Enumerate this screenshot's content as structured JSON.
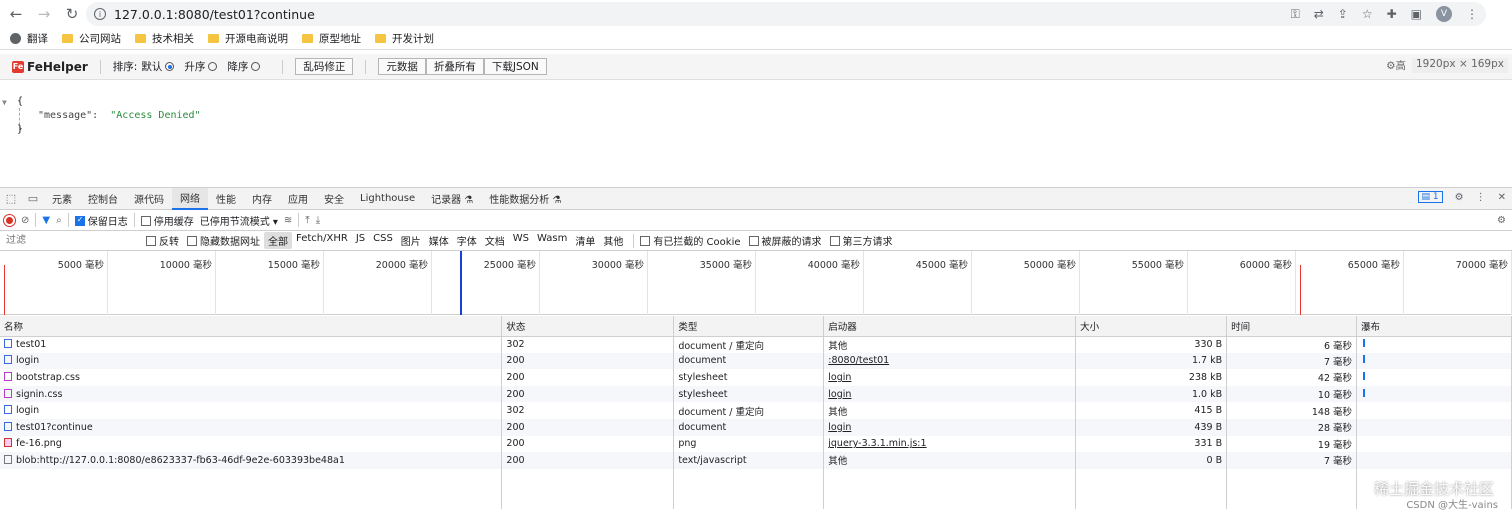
{
  "browser": {
    "url": "127.0.0.1:8080/test01?continue",
    "avatar_letter": "V"
  },
  "bookmarks": [
    "翻译",
    "公司网站",
    "技术相关",
    "开源电商说明",
    "原型地址",
    "开发计划"
  ],
  "fehelper": {
    "name": "FeHelper",
    "sort_label": "排序:",
    "sort_options": [
      "默认",
      "升序",
      "降序"
    ],
    "fix_button": "乱码修正",
    "buttons": [
      "元数据",
      "折叠所有",
      "下载JSON"
    ],
    "right_text": "高",
    "size_badge": "1920px × 169px"
  },
  "json_view": {
    "open_brace": "{",
    "close_brace": "}",
    "key": "\"message\":",
    "value": "\"Access Denied\""
  },
  "devtools": {
    "tabs": [
      "元素",
      "控制台",
      "源代码",
      "网络",
      "性能",
      "内存",
      "应用",
      "安全",
      "Lighthouse",
      "记录器 ⚗",
      "性能数据分析 ⚗"
    ],
    "active_tab": "网络",
    "issue_count": "1",
    "toolbar": {
      "preserve_log": "保留日志",
      "disable_cache": "停用缓存",
      "throttle": "已停用节流模式"
    },
    "filter": {
      "placeholder": "过滤",
      "invert": "反转",
      "hide_data_urls": "隐藏数据网址",
      "types": [
        "全部",
        "Fetch/XHR",
        "JS",
        "CSS",
        "图片",
        "媒体",
        "字体",
        "文档",
        "WS",
        "Wasm",
        "清单",
        "其他"
      ],
      "active_type": "全部",
      "blocked_cookies": "有已拦截的 Cookie",
      "blocked_requests": "被屏蔽的请求",
      "third_party": "第三方请求"
    },
    "timeline_labels": [
      "5000 毫秒",
      "10000 毫秒",
      "15000 毫秒",
      "20000 毫秒",
      "25000 毫秒",
      "30000 毫秒",
      "35000 毫秒",
      "40000 毫秒",
      "45000 毫秒",
      "50000 毫秒",
      "55000 毫秒",
      "60000 毫秒",
      "65000 毫秒",
      "70000 毫秒"
    ],
    "columns": [
      "名称",
      "状态",
      "类型",
      "启动器",
      "大小",
      "时间",
      "瀑布"
    ],
    "rows": [
      {
        "name": "test01",
        "status": "302",
        "type": "document / 重定向",
        "initiator": "其他",
        "size": "330 B",
        "time": "6 毫秒",
        "kind": "doc",
        "link": false,
        "bar": true
      },
      {
        "name": "login",
        "status": "200",
        "type": "document",
        "initiator": ":8080/test01",
        "size": "1.7 kB",
        "time": "7 毫秒",
        "kind": "doc",
        "link": true,
        "bar": true
      },
      {
        "name": "bootstrap.css",
        "status": "200",
        "type": "stylesheet",
        "initiator": "login",
        "size": "238 kB",
        "time": "42 毫秒",
        "kind": "css",
        "link": true,
        "bar": true
      },
      {
        "name": "signin.css",
        "status": "200",
        "type": "stylesheet",
        "initiator": "login",
        "size": "1.0 kB",
        "time": "10 毫秒",
        "kind": "css",
        "link": true,
        "bar": true
      },
      {
        "name": "login",
        "status": "302",
        "type": "document / 重定向",
        "initiator": "其他",
        "size": "415 B",
        "time": "148 毫秒",
        "kind": "doc",
        "link": false,
        "bar": false
      },
      {
        "name": "test01?continue",
        "status": "200",
        "type": "document",
        "initiator": "login",
        "size": "439 B",
        "time": "28 毫秒",
        "kind": "doc",
        "link": true,
        "bar": false
      },
      {
        "name": "fe-16.png",
        "status": "200",
        "type": "png",
        "initiator": "jquery-3.3.1.min.js:1",
        "size": "331 B",
        "time": "19 毫秒",
        "kind": "img",
        "link": true,
        "bar": false
      },
      {
        "name": "blob:http://127.0.0.1:8080/e8623337-fb63-46df-9e2e-603393be48a1",
        "status": "200",
        "type": "text/javascript",
        "initiator": "其他",
        "size": "0 B",
        "time": "7 毫秒",
        "kind": "blob",
        "link": false,
        "bar": false
      }
    ]
  },
  "watermark": [
    "稀土掘金技术社区",
    "CSDN @大生-vains"
  ]
}
